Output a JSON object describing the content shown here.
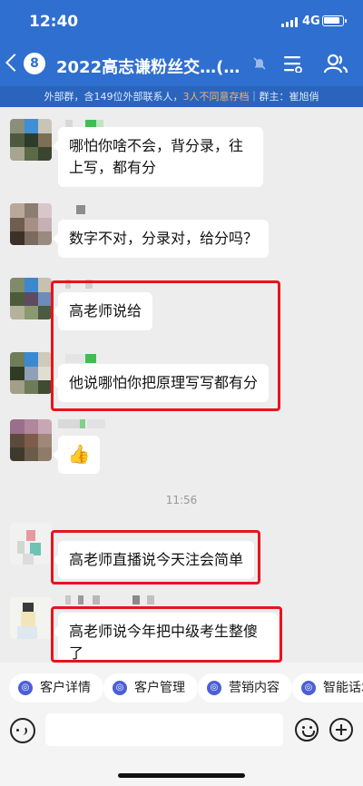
{
  "status_bar": {
    "time": "12:40",
    "network": "4G"
  },
  "header": {
    "back_badge": "8",
    "title": "2022高志谦粉丝交…(152)",
    "sub_prefix": "外部群，含149位外部联系人，",
    "sub_warning": "3人不同意存档",
    "sub_suffix": "｜群主：崔旭俏"
  },
  "messages": [
    {
      "text": "哪怕你啥不会，背分录，往上写，都有分"
    },
    {
      "text": "数字不对，分录对，给分吗？"
    },
    {
      "text": "高老师说给"
    },
    {
      "text": "他说哪怕你把原理写写都有分"
    },
    {
      "emoji": "👍"
    },
    {
      "timestamp": "11:56"
    },
    {
      "text": "高老师直播说今天注会简单"
    },
    {
      "text": "高老师说今年把中级考生整傻了",
      "emoji": "😂"
    }
  ],
  "quick_actions": [
    {
      "label": "客户详情"
    },
    {
      "label": "客户管理"
    },
    {
      "label": "营销内容"
    },
    {
      "label": "智能话术"
    }
  ],
  "colors": {
    "header": "#2f6fd0",
    "highlight_box": "#e8141c",
    "warning_text": "#f6b26b"
  }
}
